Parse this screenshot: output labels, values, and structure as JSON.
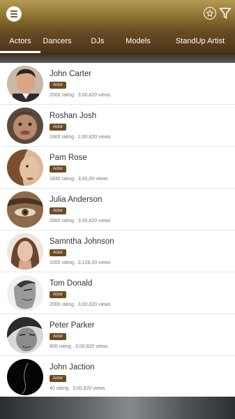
{
  "header": {
    "menu_icon": "hamburger-icon",
    "favorite_icon": "star-circle-icon",
    "filter_icon": "filter-icon"
  },
  "tabs": [
    {
      "label": "Actors",
      "active": true
    },
    {
      "label": "Dancers",
      "active": false
    },
    {
      "label": "DJs",
      "active": false
    },
    {
      "label": "Models",
      "active": false
    },
    {
      "label": "StandUp Artist",
      "active": false
    }
  ],
  "people": [
    {
      "name": "John Carter",
      "badge": "Actor",
      "stats": "2000 rating .  3,00,820 views"
    },
    {
      "name": "Roshan Josh",
      "badge": "Actor",
      "stats": "1900 rating .  2,00,820 views"
    },
    {
      "name": "Pam Rose",
      "badge": "Actor",
      "stats": "1840 rating .  3,00,00 views"
    },
    {
      "name": "Julia Anderson",
      "badge": "Actor",
      "stats": "2000 rating .  3,00,820 views"
    },
    {
      "name": "Samntha Johnson",
      "badge": "Actor",
      "stats": "1000 rating .  3,128,20 views"
    },
    {
      "name": "Tom Donald",
      "badge": "Actor",
      "stats": "2000 rating .  3,00,820 views"
    },
    {
      "name": "Peter Parker",
      "badge": "Actor",
      "stats": "800 rating .  3,00,820 views"
    },
    {
      "name": "John Jaction",
      "badge": "Actor",
      "stats": "40 rating .  3,00,820 views"
    }
  ],
  "colors": {
    "header_gold": "#9c7f3f",
    "tab_brown": "#5a3f1d",
    "badge_brown": "#6b4a25"
  }
}
